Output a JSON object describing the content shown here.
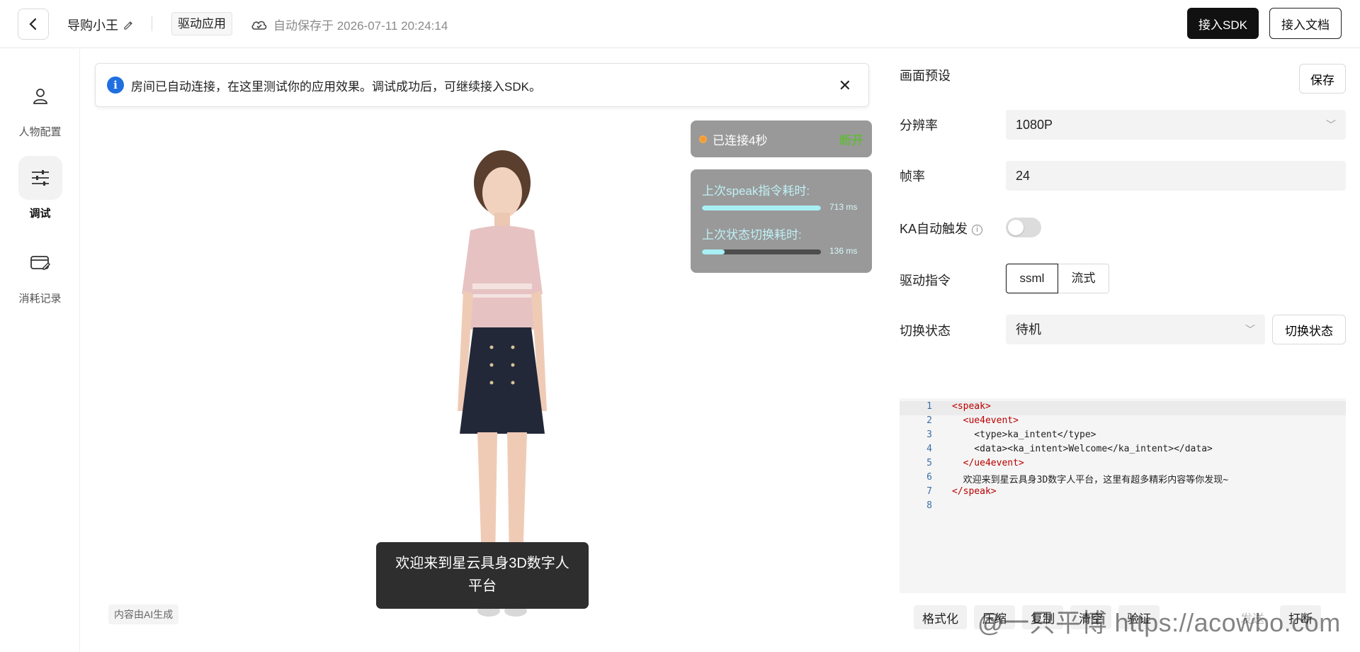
{
  "header": {
    "app_name": "导购小王",
    "mode_tag": "驱动应用",
    "autosave": "自动保存于 2026-07-11 20:24:14",
    "sdk_button": "接入SDK",
    "doc_button": "接入文档"
  },
  "sidebar": {
    "items": [
      {
        "label": "人物配置",
        "icon": "person-icon"
      },
      {
        "label": "调试",
        "icon": "sliders-icon",
        "active": true
      },
      {
        "label": "消耗记录",
        "icon": "card-edit-icon"
      }
    ]
  },
  "notice": {
    "text": "房间已自动连接，在这里测试你的应用效果。调试成功后，可继续接入SDK。"
  },
  "stage": {
    "status": "已连接4秒",
    "disconnect": "断开",
    "metric_speak_label": "上次speak指令耗时:",
    "metric_speak_value": "713 ms",
    "metric_speak_fill": 1.0,
    "metric_state_label": "上次状态切换耗时:",
    "metric_state_value": "136 ms",
    "metric_state_fill": 0.19,
    "subtitle": "欢迎来到星云具身3D数字人平台",
    "ai_tag": "内容由AI生成"
  },
  "panel": {
    "preset_label": "画面预设",
    "save_button": "保存",
    "resolution_label": "分辨率",
    "resolution_value": "1080P",
    "framerate_label": "帧率",
    "framerate_value": "24",
    "ka_label": "KA自动触发",
    "drive_label": "驱动指令",
    "drive_options": [
      "ssml",
      "流式"
    ],
    "state_label": "切换状态",
    "state_value": "待机",
    "state_button": "切换状态"
  },
  "editor": {
    "lines": [
      {
        "n": "1",
        "text": "<speak>"
      },
      {
        "n": "2",
        "text": "  <ue4event>"
      },
      {
        "n": "3",
        "text": "    <type>ka_intent</type>"
      },
      {
        "n": "4",
        "text": "    <data><ka_intent>Welcome</ka_intent></data>"
      },
      {
        "n": "5",
        "text": "  </ue4event>"
      },
      {
        "n": "6",
        "text": "  欢迎来到星云具身3D数字人平台，这里有超多精彩内容等你发现~"
      },
      {
        "n": "7",
        "text": "</speak>"
      },
      {
        "n": "8",
        "text": ""
      }
    ]
  },
  "toolbar": {
    "buttons": [
      "格式化",
      "压缩",
      "复制",
      "清空",
      "验证",
      "发送",
      "打断"
    ]
  },
  "watermark": "@一只平博 https://acowbo.com",
  "colors": {
    "accent": "#111111",
    "success": "#52c41a",
    "info": "#1f6fe0"
  }
}
